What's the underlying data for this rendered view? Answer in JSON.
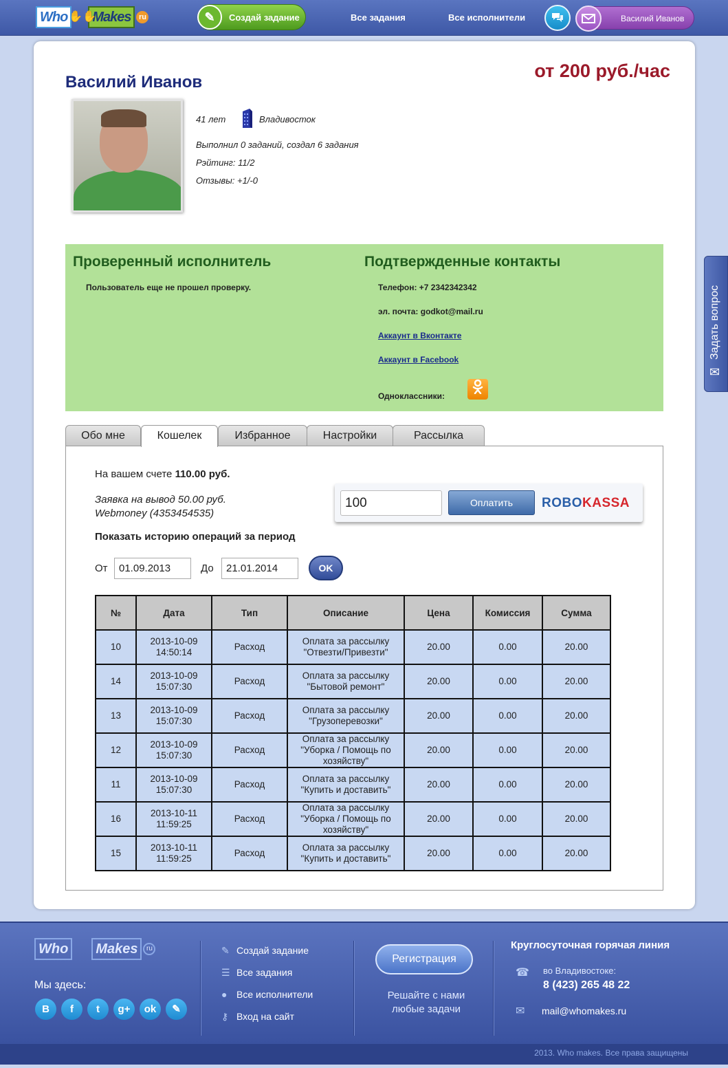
{
  "header": {
    "logo_left": "Who",
    "logo_right": "Makes",
    "logo_tld": "ru",
    "create_task": "Создай задание",
    "nav": [
      "Все задания",
      "Все исполнители"
    ],
    "user_name": "Василий Иванов"
  },
  "profile": {
    "name": "Василий Иванов",
    "rate": "от 200 руб./час",
    "age": "41 лет",
    "city": "Владивосток",
    "tasks_stat": "Выполнил 0 заданий, создал 6 задания",
    "rating": "Рэйтинг: 11/2",
    "reviews": "Отзывы: +1/-0"
  },
  "verification": {
    "checked_title": "Проверенный исполнитель",
    "checked_text": "Пользователь еще не прошел проверку.",
    "contacts_title": "Подтвержденные контакты",
    "phone": "Телефон: +7 2342342342",
    "email": "эл. почта: godkot@mail.ru",
    "vk_link": "Аккаунт в Вконтакте",
    "fb_link": "Аккаунт в Facebook",
    "ok_label": "Одноклассники:",
    "ok_icon": "odnoklassniki-icon"
  },
  "tabs": [
    "Обо мне",
    "Кошелек",
    "Избранное",
    "Настройки",
    "Рассылка"
  ],
  "active_tab": "Кошелек",
  "wallet": {
    "balance_prefix": "На вашем счете",
    "balance": "110.00 руб.",
    "withdraw_line1": "Заявка на вывод 50.00 руб.",
    "withdraw_line2": "Webmoney (4353454535)",
    "pay_amount": "100",
    "pay_button": "Оплатить",
    "robokassa_a": "ROBO",
    "robokassa_b": "KASSA",
    "history_title": "Показать историю операций за период",
    "from_label": "От",
    "from_value": "01.09.2013",
    "to_label": "До",
    "to_value": "21.01.2014",
    "ok_button": "OK"
  },
  "operations": {
    "columns": [
      "№",
      "Дата",
      "Тип",
      "Описание",
      "Цена",
      "Комиссия",
      "Сумма"
    ],
    "rows": [
      [
        "10",
        "2013-10-09 14:50:14",
        "Расход",
        "Оплата за рассылку \"Отвезти/Привезти\"",
        "20.00",
        "0.00",
        "20.00"
      ],
      [
        "14",
        "2013-10-09 15:07:30",
        "Расход",
        "Оплата за рассылку \"Бытовой ремонт\"",
        "20.00",
        "0.00",
        "20.00"
      ],
      [
        "13",
        "2013-10-09 15:07:30",
        "Расход",
        "Оплата за рассылку \"Грузоперевозки\"",
        "20.00",
        "0.00",
        "20.00"
      ],
      [
        "12",
        "2013-10-09 15:07:30",
        "Расход",
        "Оплата за рассылку \"Уборка / Помощь по хозяйству\"",
        "20.00",
        "0.00",
        "20.00"
      ],
      [
        "11",
        "2013-10-09 15:07:30",
        "Расход",
        "Оплата за рассылку \"Купить и доставить\"",
        "20.00",
        "0.00",
        "20.00"
      ],
      [
        "16",
        "2013-10-11 11:59:25",
        "Расход",
        "Оплата за рассылку \"Уборка / Помощь по хозяйству\"",
        "20.00",
        "0.00",
        "20.00"
      ],
      [
        "15",
        "2013-10-11 11:59:25",
        "Расход",
        "Оплата за рассылку \"Купить и доставить\"",
        "20.00",
        "0.00",
        "20.00"
      ]
    ]
  },
  "side_button": "Задать вопрос",
  "footer": {
    "we_are_here": "Мы здесь:",
    "social_icons": [
      "vk-icon",
      "facebook-icon",
      "twitter-icon",
      "google-plus-icon",
      "odnoklassniki-icon",
      "livejournal-icon"
    ],
    "links": [
      "Создай задание",
      "Все задания",
      "Все исполнители",
      "Вход на сайт"
    ],
    "register": "Регистрация",
    "slogan": "Решайте с нами любые задачи",
    "hotline_title": "Круглосуточная горячая линия",
    "hotline_city": "во Владивостоке:",
    "hotline_phone": "8 (423) 265 48 22",
    "hotline_email": "mail@whomakes.ru",
    "copyright": "2013. Who makes. Все права защищены"
  }
}
